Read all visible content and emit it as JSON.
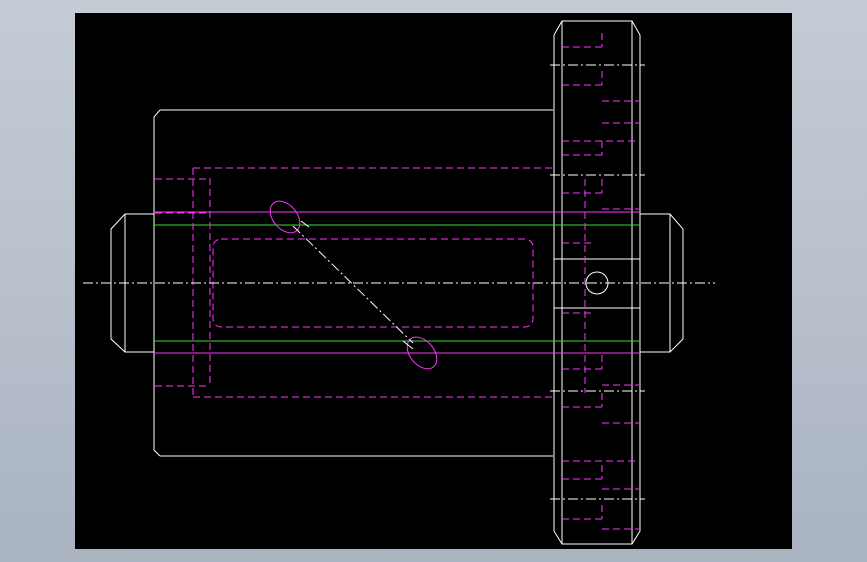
{
  "colors": {
    "background": "#000000",
    "frame": "#b8c0cc",
    "visible_edges": "#ffffff",
    "hidden_edges": "#ff33ff",
    "bore_lines": "#33dd33"
  },
  "view": {
    "type": "cad-orthographic-side-view",
    "icons": [
      "cylinder-body",
      "spur-gear",
      "shaft-end-left",
      "shaft-end-right",
      "helical-slot",
      "pin-hole"
    ]
  }
}
